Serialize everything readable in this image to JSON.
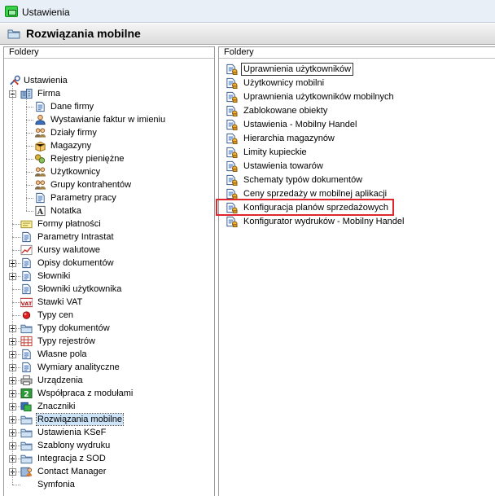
{
  "window": {
    "title": "Ustawienia"
  },
  "header": {
    "title": "Rozwiązania mobilne"
  },
  "left_pane": {
    "header": "Foldery",
    "root": "Ustawienia",
    "firma": {
      "label": "Firma",
      "children": [
        "Dane firmy",
        "Wystawianie faktur w imieniu",
        "Działy firmy",
        "Magazyny",
        "Rejestry pieniężne",
        "Użytkownicy",
        "Grupy kontrahentów",
        "Parametry pracy",
        "Notatka"
      ]
    },
    "items": [
      {
        "label": "Formy płatności",
        "icon": "payment-forms-icon",
        "expandable": false
      },
      {
        "label": "Parametry Intrastat",
        "icon": "document-icon",
        "expandable": false
      },
      {
        "label": "Kursy walutowe",
        "icon": "chart-icon",
        "expandable": false
      },
      {
        "label": "Opisy dokumentów",
        "icon": "document-icon",
        "expandable": true
      },
      {
        "label": "Słowniki",
        "icon": "document-icon",
        "expandable": true
      },
      {
        "label": "Słowniki użytkownika",
        "icon": "document-icon",
        "expandable": false
      },
      {
        "label": "Stawki VAT",
        "icon": "vat-icon",
        "expandable": false
      },
      {
        "label": "Typy cen",
        "icon": "red-dot-icon",
        "expandable": false
      },
      {
        "label": "Typy dokumentów",
        "icon": "folder-icon",
        "expandable": true
      },
      {
        "label": "Typy rejestrów",
        "icon": "grid-icon",
        "expandable": true
      },
      {
        "label": "Własne pola",
        "icon": "document-icon",
        "expandable": true
      },
      {
        "label": "Wymiary analityczne",
        "icon": "document-icon",
        "expandable": true
      },
      {
        "label": "Urządzenia",
        "icon": "printer-icon",
        "expandable": true
      },
      {
        "label": "Współpraca z modułami",
        "icon": "module-icon",
        "expandable": true
      },
      {
        "label": "Znaczniki",
        "icon": "tag-icon",
        "expandable": true
      },
      {
        "label": "Rozwiązania mobilne",
        "icon": "folder-icon",
        "expandable": true
      },
      {
        "label": "Ustawienia KSeF",
        "icon": "folder-icon",
        "expandable": true
      },
      {
        "label": "Szablony wydruku",
        "icon": "folder-icon",
        "expandable": true
      },
      {
        "label": "Integracja z SOD",
        "icon": "folder-icon",
        "expandable": true
      },
      {
        "label": "Contact Manager",
        "icon": "contact-icon",
        "expandable": true
      },
      {
        "label": "Symfonia",
        "icon": "none",
        "expandable": false
      }
    ]
  },
  "right_pane": {
    "header": "Foldery",
    "items": [
      "Uprawnienia użytkowników",
      "Użytkownicy mobilni",
      "Uprawnienia użytkowników mobilnych",
      "Zablokowane obiekty",
      "Ustawienia - Mobilny Handel",
      "Hierarchia magazynów",
      "Limity kupieckie",
      "Ustawienia towarów",
      "Schematy typów dokumentów",
      "Ceny sprzedaży w mobilnej aplikacji",
      "Konfiguracja planów sprzedażowych",
      "Konfigurator wydruków - Mobilny Handel"
    ],
    "highlighted_item": "Konfiguracja planów sprzedażowych"
  },
  "colors": {
    "highlight": "#e0262d",
    "selection": "#cde3f7",
    "titlebar": "#e8eff7"
  }
}
